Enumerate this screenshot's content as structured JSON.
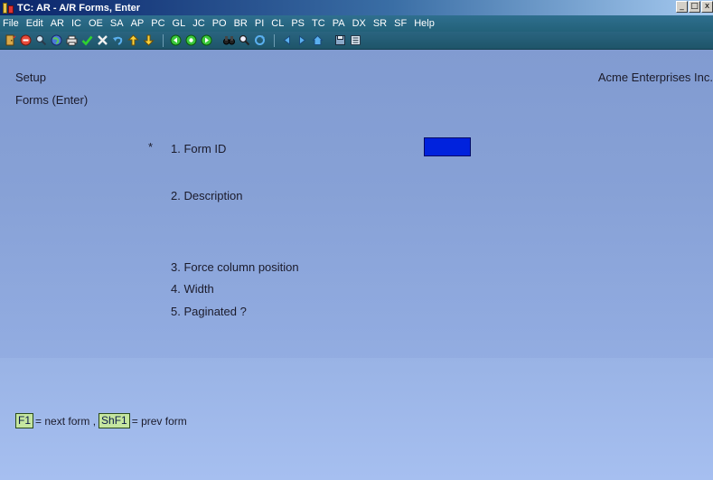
{
  "window": {
    "title": "TC: AR - A/R Forms, Enter",
    "controls": [
      "_",
      "□",
      "x"
    ]
  },
  "menubar": [
    "File",
    "Edit",
    "AR",
    "IC",
    "OE",
    "SA",
    "AP",
    "PC",
    "GL",
    "JC",
    "PO",
    "BR",
    "PI",
    "CL",
    "PS",
    "TC",
    "PA",
    "DX",
    "SR",
    "SF",
    "Help"
  ],
  "toolbar": {
    "icons": [
      "door-icon",
      "stop-icon",
      "search-icon",
      "globe-icon",
      "printer-icon",
      "checkmark-icon",
      "delete-icon",
      "undo-icon",
      "up-arrow-icon",
      "down-arrow-icon",
      "first-record-icon",
      "refresh-icon",
      "last-record-icon",
      "binoculars-icon",
      "zoom-icon",
      "reload-icon",
      "prev-icon",
      "next-icon",
      "home-icon",
      "save-icon",
      "options-icon"
    ]
  },
  "header": {
    "left_top": "Setup",
    "left_sub": "Forms (Enter)",
    "company": "Acme Enterprises Inc."
  },
  "form": {
    "required_marker": "*",
    "fields": [
      {
        "label": "1. Form ID"
      },
      {
        "label": "2. Description"
      },
      {
        "label": "3. Force column position"
      },
      {
        "label": "4. Width"
      },
      {
        "label": "5. Paginated ?"
      }
    ]
  },
  "hints": {
    "f1_key": "F1",
    "f1_text": "= next form ,",
    "shf1_key": "ShF1",
    "shf1_text": "= prev form"
  },
  "colors": {
    "background": "#87a1d6",
    "active_field": "#0022dd",
    "key_badge": "#c5e6a0"
  }
}
